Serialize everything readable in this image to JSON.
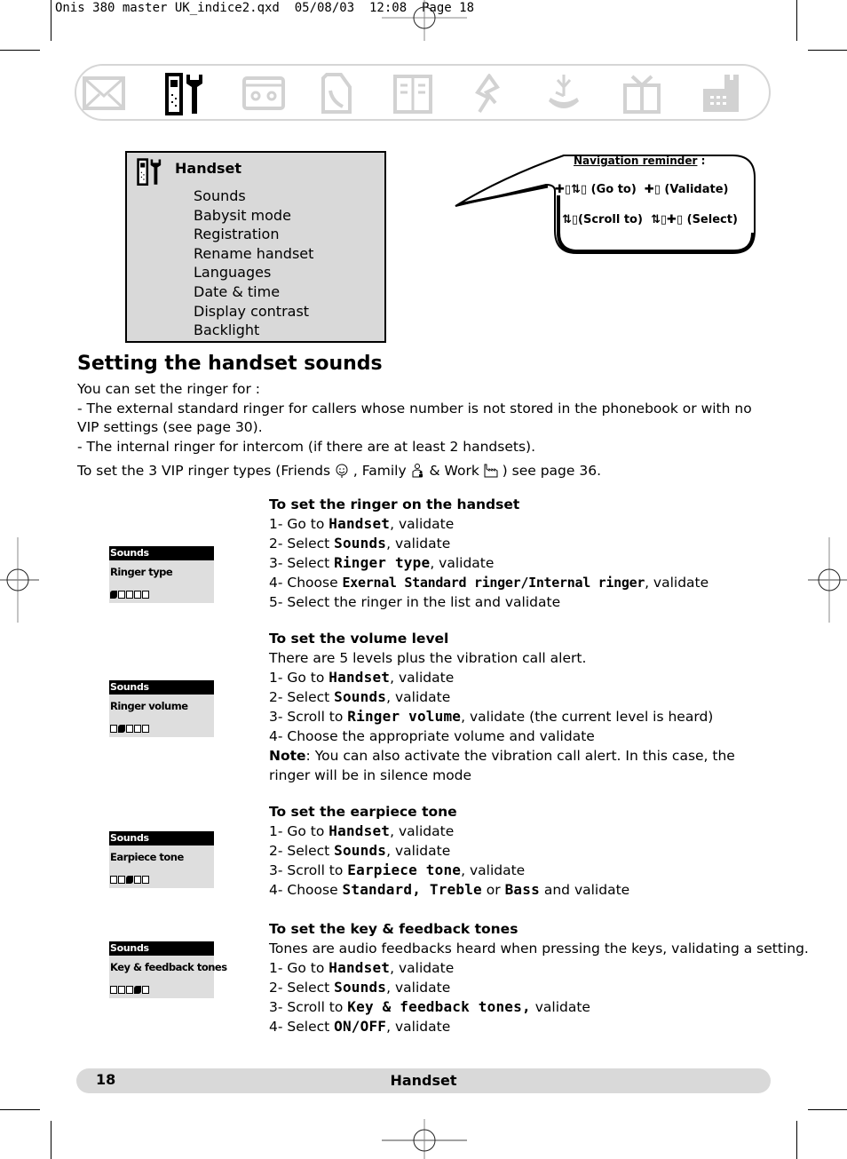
{
  "slug": {
    "text": "Onis 380 master UK_indice2.qxd  05/08/03  12:08  Page 18"
  },
  "tab_bar": {
    "tabs": [
      {
        "icon": "envelope-icon",
        "active": false
      },
      {
        "icon": "handset-tools-icon",
        "active": true
      },
      {
        "icon": "answering-machine-icon",
        "active": false
      },
      {
        "icon": "phone-call-icon",
        "active": false
      },
      {
        "icon": "phonebook-icon",
        "active": false
      },
      {
        "icon": "services-icon",
        "active": false
      },
      {
        "icon": "alarm-icon",
        "active": false
      },
      {
        "icon": "gift-icon",
        "active": false
      },
      {
        "icon": "base-settings-icon",
        "active": false
      }
    ]
  },
  "menu_box": {
    "title": "Handset",
    "items": [
      "Sounds",
      "Babysit mode",
      "Registration",
      "Rename handset",
      "Languages",
      "Date & time",
      "Display contrast",
      "Backlight"
    ]
  },
  "navigation_reminder": {
    "title": "Navigation reminder",
    "title_suffix": " :",
    "go_to": "(Go to)",
    "validate": "(Validate)",
    "scroll_to": "(Scroll to)",
    "select": "(Select)"
  },
  "main": {
    "title": "Setting the handset sounds",
    "intro": [
      "You can set the ringer for :",
      "- The external standard ringer for callers whose number is not stored in the phonebook or with no VIP settings (see page 30).",
      "- The internal ringer for intercom (if there are at least 2 handsets)."
    ],
    "vip_line": {
      "prefix": "To set the 3 VIP ringer types (Friends ",
      "family": ", Family ",
      "work": " & Work ",
      "suffix": " ) see page 36."
    }
  },
  "sections": [
    {
      "heading": "To set the ringer on the handset",
      "lines": [
        {
          "pre": "1- Go to ",
          "kw": "Handset",
          "post": ", validate"
        },
        {
          "pre": "2- Select ",
          "kw": "Sounds",
          "post": ", validate"
        },
        {
          "pre": "3- Select ",
          "kw": "Ringer type",
          "post": ", validate"
        },
        {
          "pre": "4- Choose ",
          "kw": "Exernal Standard ringer/Internal ringer",
          "post": ", validate"
        },
        {
          "pre": "5- Select the ringer in the list and validate",
          "kw": "",
          "post": ""
        }
      ],
      "screen": {
        "header": "Sounds",
        "label": "Ringer type",
        "level": 1,
        "levels": 5
      }
    },
    {
      "heading": "To set the volume level",
      "lines": [
        {
          "pre": "There are 5 levels plus the vibration call alert.",
          "kw": "",
          "post": ""
        },
        {
          "pre": "1- Go to ",
          "kw": "Handset",
          "post": ", validate"
        },
        {
          "pre": "2- Select ",
          "kw": "Sounds",
          "post": ", validate"
        },
        {
          "pre": "3- Scroll to ",
          "kw": "Ringer volume",
          "post": ", validate (the current level is heard)"
        },
        {
          "pre": "4- Choose the appropriate volume and validate",
          "kw": "",
          "post": ""
        }
      ],
      "note_label": "Note",
      "note_text": ": You can also activate the vibration call alert. In this case, the ringer will be in silence mode",
      "screen": {
        "header": "Sounds",
        "label": "Ringer volume",
        "level": 2,
        "levels": 5
      }
    },
    {
      "heading": "To set the earpiece tone",
      "lines": [
        {
          "pre": "1- Go to ",
          "kw": "Handset",
          "post": ", validate"
        },
        {
          "pre": "2- Select ",
          "kw": "Sounds",
          "post": ", validate"
        },
        {
          "pre": "3- Scroll to ",
          "kw": "Earpiece tone",
          "post": ", validate"
        },
        {
          "pre": "4- Choose ",
          "kw": "Standard, Treble",
          "post": " or ",
          "kw2": "Bass",
          "post2": " and validate"
        }
      ],
      "screen": {
        "header": "Sounds",
        "label": "Earpiece tone",
        "level": 3,
        "levels": 5
      }
    },
    {
      "heading": "To set the key & feedback tones",
      "lines": [
        {
          "pre": "Tones are audio feedbacks heard when pressing the keys, validating a setting.",
          "kw": "",
          "post": ""
        },
        {
          "pre": "1- Go to ",
          "kw": "Handset",
          "post": ", validate"
        },
        {
          "pre": "2- Select ",
          "kw": "Sounds",
          "post": ", validate"
        },
        {
          "pre": "3- Scroll to ",
          "kw": "Key & feedback tones,",
          "post": " validate"
        },
        {
          "pre": "4- Select ",
          "kw": "ON/OFF",
          "post": ", validate"
        }
      ],
      "screen": {
        "header": "Sounds",
        "label": "Key & feedback tones",
        "level": 4,
        "levels": 5
      }
    }
  ],
  "footer": {
    "page_number": "18",
    "section_name": "Handset"
  }
}
